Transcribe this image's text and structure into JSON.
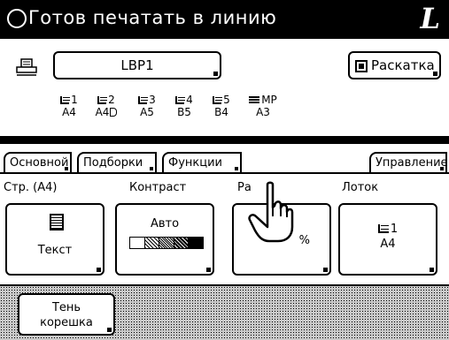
{
  "header": {
    "status_text": "Готов печатать в линию",
    "mode_badge": "L"
  },
  "printer": {
    "name": "LBP1",
    "sort_label": "Раскатка",
    "trays": [
      {
        "tray": "1",
        "size": "A4",
        "icon": "tray-icon"
      },
      {
        "tray": "2",
        "size": "A4",
        "icon": "tray-icon",
        "orientation_icon": "landscape-page-icon"
      },
      {
        "tray": "3",
        "size": "A5",
        "icon": "tray-icon"
      },
      {
        "tray": "4",
        "size": "B5",
        "icon": "tray-icon"
      },
      {
        "tray": "5",
        "size": "B4",
        "icon": "tray-icon"
      },
      {
        "tray": "MP",
        "size": "A3",
        "icon": "multipurpose-tray-icon"
      }
    ]
  },
  "tabs": [
    {
      "label": "Основной",
      "active": true
    },
    {
      "label": "Подборки",
      "active": false
    },
    {
      "label": "Функции",
      "active": false
    },
    {
      "label": "Управление",
      "active": false
    }
  ],
  "functions": {
    "page_label": "Стр. (A4)",
    "page_value": "Текст",
    "contrast_label": "Контраст",
    "contrast_value": "Авто",
    "size_label": "Ра",
    "size_value": "%",
    "tray_label": "Лоток",
    "tray_value_num": "1",
    "tray_value_size": "A4"
  },
  "bottom": {
    "spine_line1": "Тень",
    "spine_line2": "корешка"
  }
}
